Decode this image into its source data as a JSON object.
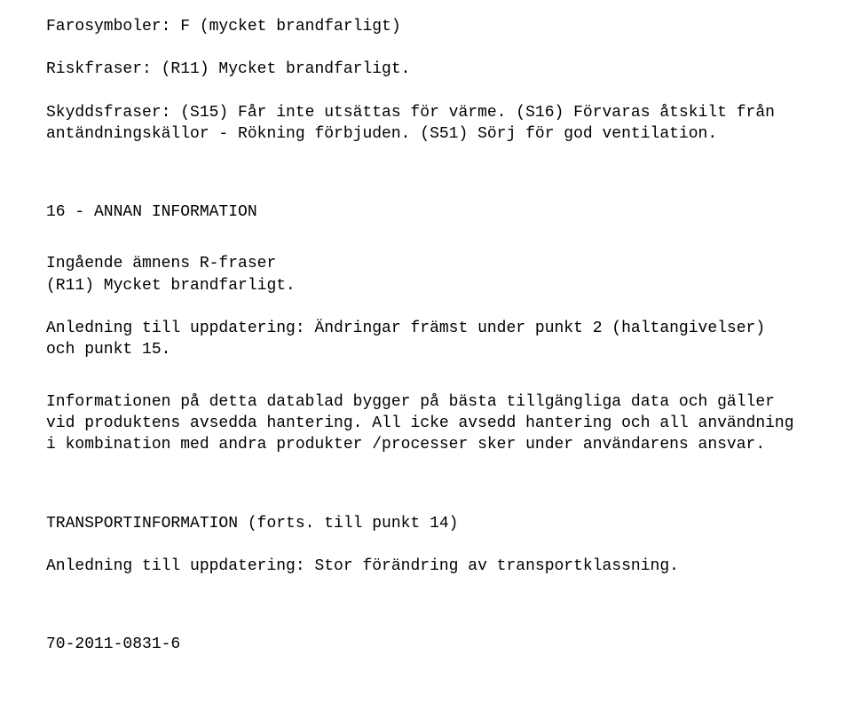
{
  "lines": {
    "farosymboler": "Farosymboler: F (mycket brandfarligt)",
    "riskfraser": "Riskfraser: (R11) Mycket brandfarligt.",
    "skyddsfraser": "Skyddsfraser: (S15) Får inte utsättas för värme. (S16) Förvaras åtskilt från antändningskällor - Rökning förbjuden. (S51) Sörj för god ventilation.",
    "section16_heading": "16 - ANNAN INFORMATION",
    "ingaende_title": "Ingående ämnens R-fraser",
    "ingaende_line1": "(R11) Mycket brandfarligt.",
    "anledning1": "Anledning till uppdatering: Ändringar främst under punkt 2 (haltangivelser) och punkt 15.",
    "info_para": "Informationen på detta datablad bygger på bästa tillgängliga data och gäller vid produktens avsedda hantering. All icke avsedd hantering och all användning i kombination med andra produkter /processer sker under användarens ansvar.",
    "transport_heading": "TRANSPORTINFORMATION (forts. till punkt 14)",
    "anledning2": "Anledning till uppdatering: Stor förändring av transportklassning.",
    "footer_code": "70-2011-0831-6"
  }
}
